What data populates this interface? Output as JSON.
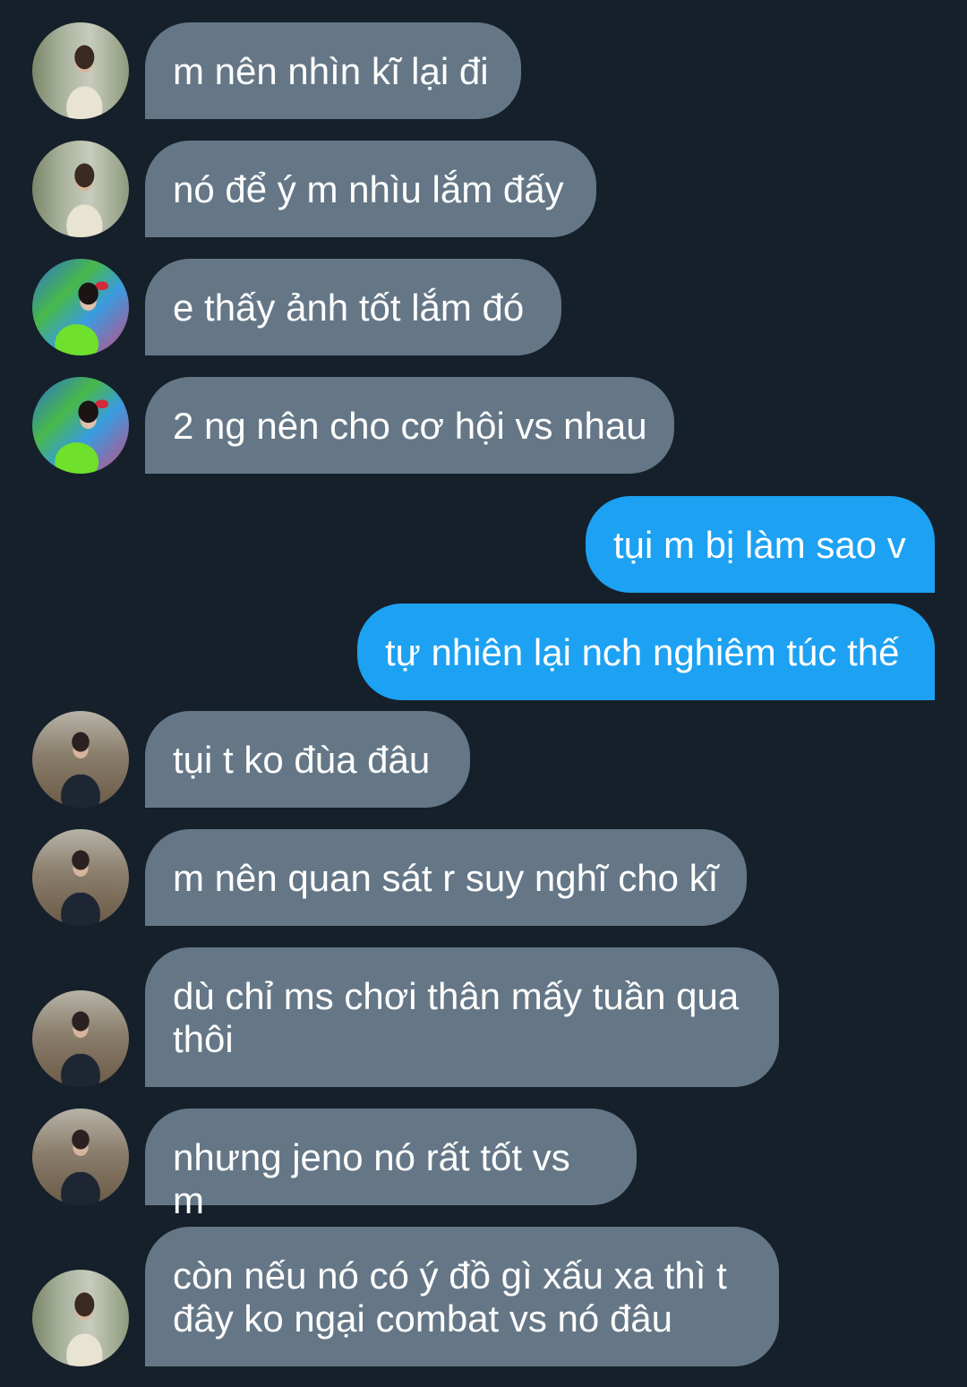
{
  "colors": {
    "background": "#15202b",
    "incoming_bubble": "#657786",
    "outgoing_bubble": "#1da1f2",
    "text": "#ffffff"
  },
  "messages": [
    {
      "direction": "incoming",
      "avatar": "avatar-a",
      "text": "m nên nhìn kĩ lại đi"
    },
    {
      "direction": "incoming",
      "avatar": "avatar-a",
      "text": "nó để ý m nhìu lắm đấy"
    },
    {
      "direction": "incoming",
      "avatar": "avatar-b",
      "text": "e thấy ảnh tốt lắm đó"
    },
    {
      "direction": "incoming",
      "avatar": "avatar-b",
      "text": "2 ng nên cho cơ hội vs nhau"
    },
    {
      "direction": "outgoing",
      "text": "tụi m bị làm sao v"
    },
    {
      "direction": "outgoing",
      "text": "tự nhiên lại nch nghiêm túc thế"
    },
    {
      "direction": "incoming",
      "avatar": "avatar-c",
      "text": "tụi t ko đùa đâu"
    },
    {
      "direction": "incoming",
      "avatar": "avatar-c",
      "text": "m nên quan sát r suy nghĩ cho kĩ"
    },
    {
      "direction": "incoming",
      "avatar": "avatar-c",
      "text": "dù chỉ ms chơi thân mấy tuần qua\nthôi"
    },
    {
      "direction": "incoming",
      "avatar": "avatar-c",
      "text": "nhưng jeno nó rất tốt vs m"
    },
    {
      "direction": "incoming",
      "avatar": "avatar-a",
      "text": "còn nếu nó có ý đồ gì xấu xa thì t\nđây ko ngại combat vs nó đâu"
    }
  ]
}
